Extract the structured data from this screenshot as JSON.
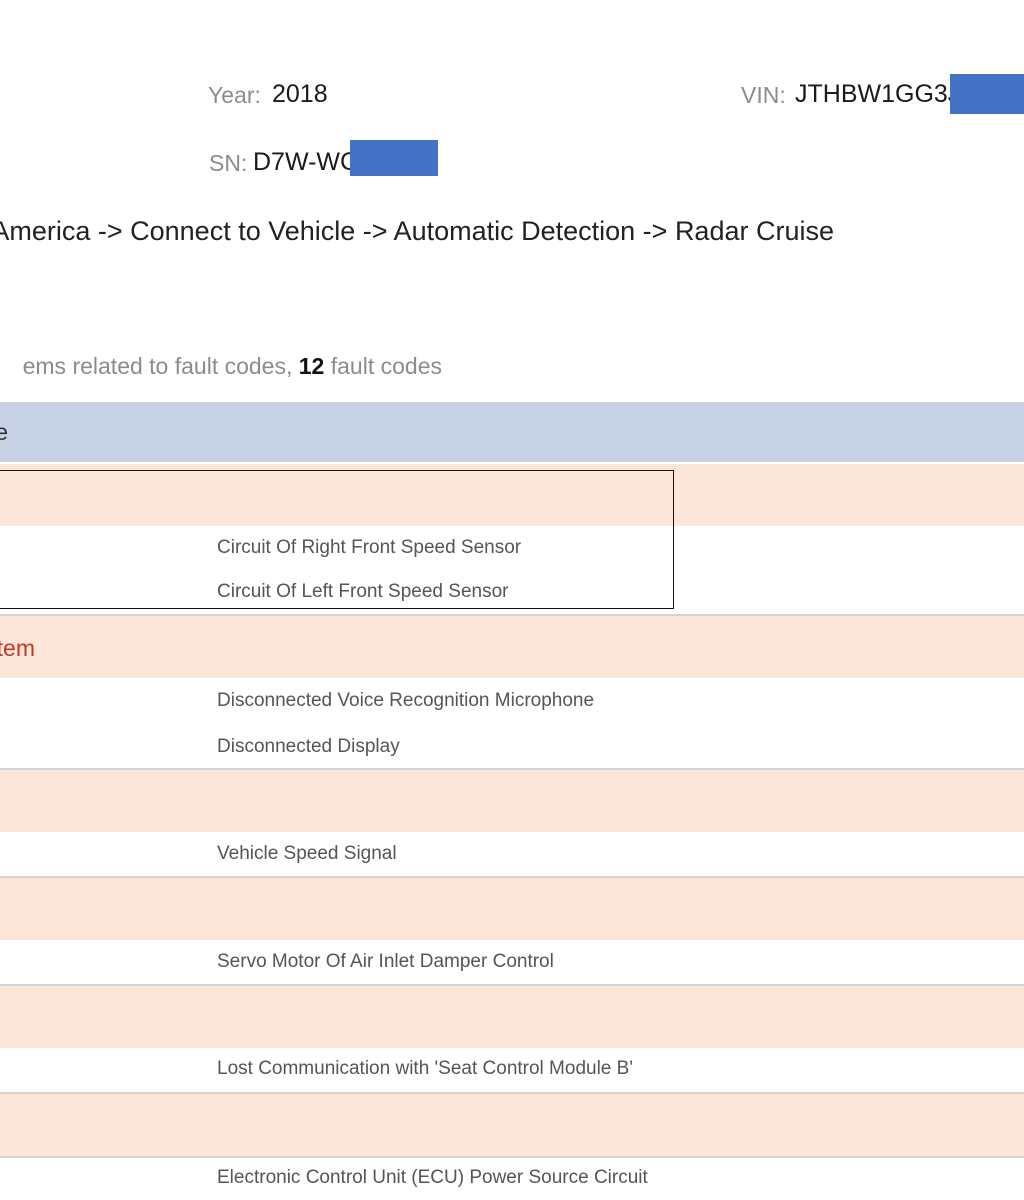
{
  "vehicle_info": {
    "year_label": "Year:",
    "year_value": "2018",
    "vin_label": "VIN:",
    "vin_value": "JTHBW1GG3J",
    "sn_label": "SN:",
    "sn_value": "D7W-WC"
  },
  "breadcrumb": "n America -> Connect to Vehicle -> Automatic Detection -> Radar Cruise",
  "summary": {
    "prefix": "ems related to fault codes, ",
    "count": "12",
    "suffix": " fault codes"
  },
  "table": {
    "header": "e",
    "groups": [
      {
        "system": "",
        "codes": [
          "Circuit Of Right Front Speed Sensor",
          "Circuit Of Left Front Speed Sensor"
        ]
      },
      {
        "system": "tem",
        "codes": [
          "Disconnected Voice Recognition Microphone",
          "Disconnected Display"
        ]
      },
      {
        "system": "",
        "codes": [
          "Vehicle Speed Signal"
        ]
      },
      {
        "system": "",
        "codes": [
          "Servo Motor Of Air Inlet Damper Control"
        ]
      },
      {
        "system": "",
        "codes": [
          "Lost Communication with 'Seat Control Module B'"
        ]
      },
      {
        "system": "",
        "codes": [
          "Electronic Control Unit (ECU) Power Source Circuit"
        ]
      }
    ]
  },
  "colors": {
    "header_bg": "#c6d1e6",
    "system_row_bg": "#fce6da",
    "system_text": "#c0392b",
    "redaction": "#4472c4"
  }
}
